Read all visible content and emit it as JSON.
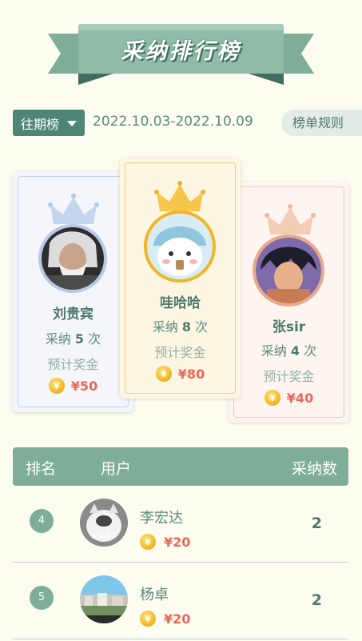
{
  "header": {
    "title": "采纳排行榜"
  },
  "filter": {
    "period_label": "往期榜",
    "date_range": "2022.10.03-2022.10.09",
    "rules_label": "榜单规则"
  },
  "podium": [
    {
      "rank": 1,
      "name": "哇哈哈",
      "adopt_prefix": "采纳",
      "count": "8",
      "adopt_suffix": "次",
      "prize_label": "预计奖金",
      "amount": "¥80"
    },
    {
      "rank": 2,
      "name": "刘贵宾",
      "adopt_prefix": "采纳",
      "count": "5",
      "adopt_suffix": "次",
      "prize_label": "预计奖金",
      "amount": "¥50"
    },
    {
      "rank": 3,
      "name": "张sir",
      "adopt_prefix": "采纳",
      "count": "4",
      "adopt_suffix": "次",
      "prize_label": "预计奖金",
      "amount": "¥40"
    }
  ],
  "table": {
    "headers": {
      "rank": "排名",
      "user": "用户",
      "count": "采纳数"
    },
    "rows": [
      {
        "rank": "4",
        "name": "李宏达",
        "amount": "¥20",
        "count": "2"
      },
      {
        "rank": "5",
        "name": "杨卓",
        "amount": "¥20",
        "count": "2"
      }
    ]
  },
  "avatar_labels": {
    "row_4": "没得救了"
  },
  "colors": {
    "primary": "#4f8478",
    "header_bg": "#7ead98",
    "accent_red": "#e8675a",
    "gold": "#f3b928",
    "page_bg": "#fdfcf0"
  }
}
